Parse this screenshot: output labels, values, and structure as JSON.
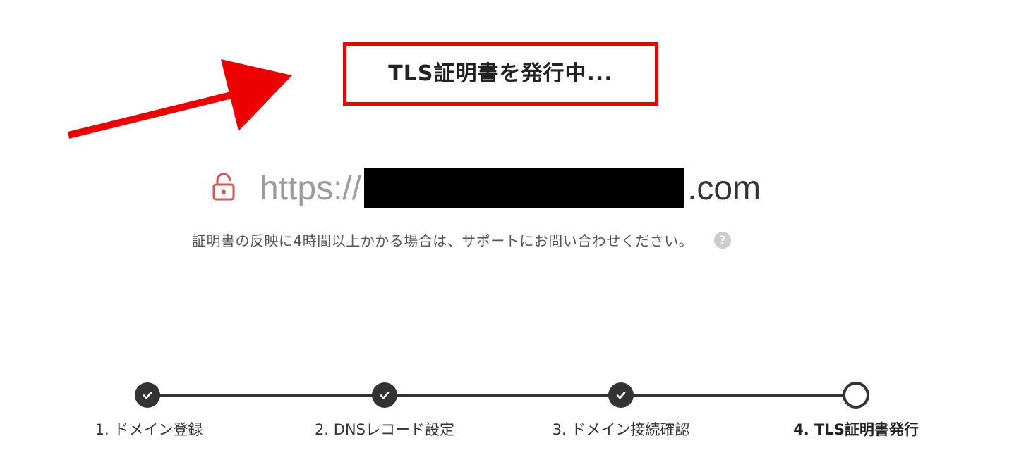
{
  "status": {
    "title": "TLS証明書を発行中..."
  },
  "url": {
    "scheme": "https://",
    "tld": ".com"
  },
  "note": {
    "text": "証明書の反映に4時間以上かかる場合は、サポートにお問い合わせください。",
    "help_glyph": "?"
  },
  "icons": {
    "lock": "lock-open-icon",
    "help": "help-circle-icon",
    "check": "check-icon"
  },
  "colors": {
    "annotation": "#ee0000",
    "lock": "#d9534f",
    "step_active": "#333333"
  },
  "steps": [
    {
      "label": "1. ドメイン登録",
      "state": "done"
    },
    {
      "label": "2. DNSレコード設定",
      "state": "done"
    },
    {
      "label": "3. ドメイン接続確認",
      "state": "done"
    },
    {
      "label": "4. TLS証明書発行",
      "state": "current"
    }
  ]
}
